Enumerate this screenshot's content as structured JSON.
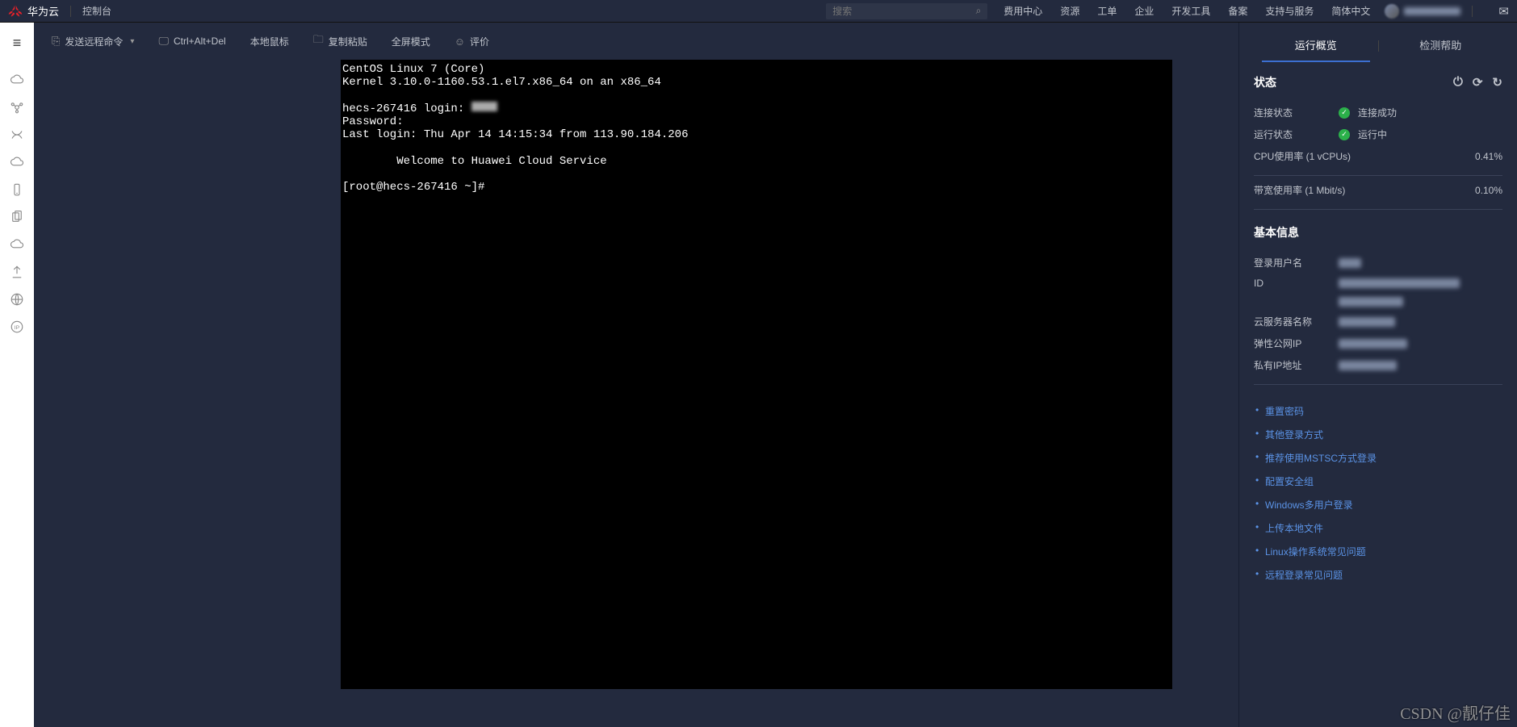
{
  "header": {
    "brand": "华为云",
    "console": "控制台",
    "search_placeholder": "搜索",
    "nav": [
      "费用中心",
      "资源",
      "工单",
      "企业",
      "开发工具",
      "备案",
      "支持与服务",
      "简体中文"
    ]
  },
  "left_rail_icons": [
    "menu-icon",
    "cloud-icon",
    "compute-icon",
    "network-icon",
    "cloud2-icon",
    "mobile-icon",
    "copy-icon",
    "cloud3-icon",
    "upload-icon",
    "globe-icon",
    "eip-icon"
  ],
  "toolbar": {
    "send_cmd": "发送远程命令",
    "ctrl_alt_del": "Ctrl+Alt+Del",
    "local_mouse": "本地鼠标",
    "paste": "复制粘贴",
    "fullscreen": "全屏模式",
    "feedback": "评价"
  },
  "terminal": {
    "line1": "CentOS Linux 7 (Core)",
    "line2": "Kernel 3.10.0-1160.53.1.el7.x86_64 on an x86_64",
    "line3a": "hecs-267416 login: ",
    "line4": "Password:",
    "line5": "Last login: Thu Apr 14 14:15:34 from 113.90.184.206",
    "line6": "        Welcome to Huawei Cloud Service",
    "line7": "[root@hecs-267416 ~]#"
  },
  "right_panel": {
    "tabs": {
      "overview": "运行概览",
      "help": "检测帮助"
    },
    "status_title": "状态",
    "conn_label": "连接状态",
    "conn_value": "连接成功",
    "run_label": "运行状态",
    "run_value": "运行中",
    "cpu_label": "CPU使用率 (1 vCPUs)",
    "cpu_value": "0.41%",
    "bw_label": "带宽使用率 (1 Mbit/s)",
    "bw_value": "0.10%",
    "basic_title": "基本信息",
    "basic_rows": {
      "login_user": "登录用户名",
      "id": "ID",
      "name": "云服务器名称",
      "eip": "弹性公网IP",
      "private_ip": "私有IP地址"
    },
    "links": [
      "重置密码",
      "其他登录方式",
      "推荐使用MSTSC方式登录",
      "配置安全组",
      "Windows多用户登录",
      "上传本地文件",
      "Linux操作系统常见问题",
      "远程登录常见问题"
    ]
  },
  "watermark": "CSDN @靓仔佳"
}
